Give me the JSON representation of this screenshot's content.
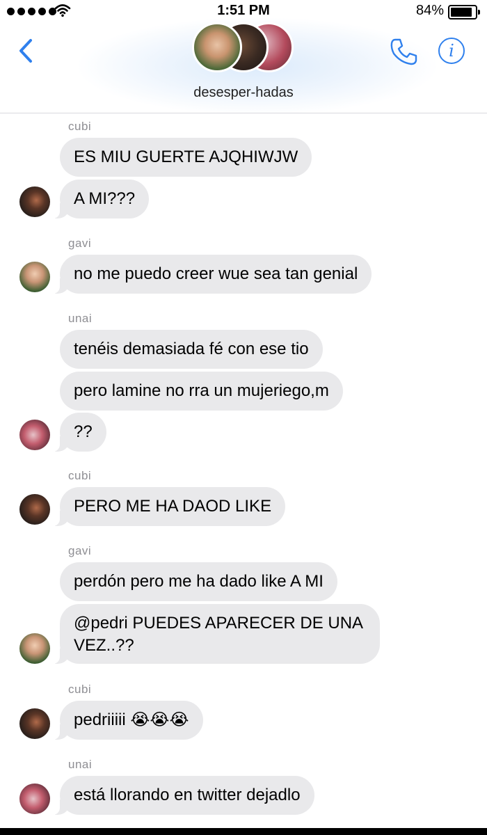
{
  "status_bar": {
    "time": "1:51 PM",
    "battery": "84%",
    "signal_icon": "signal-dots-icon",
    "wifi_icon": "wifi-icon",
    "battery_icon": "battery-icon"
  },
  "header": {
    "group_name": "desesper-hadas",
    "back_icon": "chevron-left-icon",
    "call_icon": "phone-icon",
    "info_icon": "info-icon",
    "info_glyph": "i",
    "accent_color": "#2f80ed"
  },
  "messages": [
    {
      "sender": "cubi",
      "text": "ES MIU GUERTE AJQHIWJW"
    },
    {
      "sender": "",
      "text": "A MI???"
    },
    {
      "sender": "gavi",
      "text": "no me puedo creer wue sea tan genial"
    },
    {
      "sender": "unai",
      "text": "tenéis demasiada fé con ese tio"
    },
    {
      "sender": "",
      "text": "pero lamine no rra un mujeriego,m"
    },
    {
      "sender": "",
      "text": "??"
    },
    {
      "sender": "cubi",
      "text": "PERO ME HA DAOD LIKE"
    },
    {
      "sender": "gavi",
      "text": "perdón pero me ha dado like A MI"
    },
    {
      "sender": "",
      "text": "@pedri PUEDES APARECER DE UNA VEZ..??"
    },
    {
      "sender": "cubi",
      "text": "pedriiiii 😭😭😭"
    },
    {
      "sender": "unai",
      "text": "está llorando en twitter dejadlo"
    }
  ],
  "colors": {
    "bubble": "#e9e9eb",
    "sender_label": "#8e8e93"
  }
}
